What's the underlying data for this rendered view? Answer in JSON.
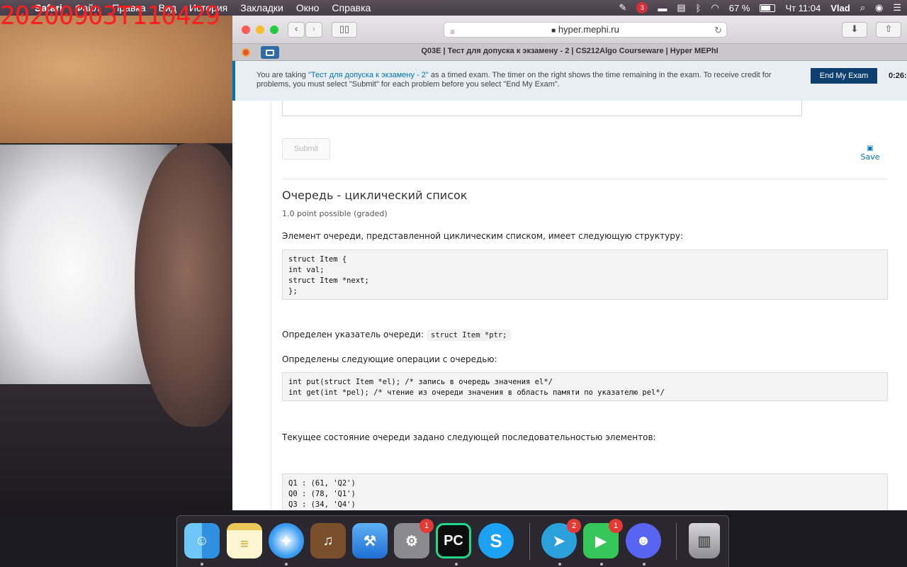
{
  "overlay_timestamp": "20200903T110429",
  "menubar": {
    "app_name": "Safari",
    "items": [
      "Файл",
      "Правка",
      "Вид",
      "История",
      "Закладки",
      "Окно",
      "Справка"
    ],
    "notification_badge": "3",
    "battery": "67 %",
    "clock": "Чт 11:04",
    "user": "Vlad"
  },
  "browser": {
    "url": "hyper.mephi.ru",
    "tab_title": "Q03E | Тест для допуска к экзамену - 2 | CS212Algo Courseware | Hyper MEPhI"
  },
  "exam_notice": {
    "prefix": "You are taking ",
    "exam_link": "\"Тест для допуска к экзамену - 2\"",
    "suffix": " as a timed exam. The timer on the right shows the time remaining in the exam. To receive credit for problems, you must select \"Submit\" for each problem before you select \"End My Exam\".",
    "end_button": "End My Exam",
    "timer": "0:26:"
  },
  "problem": {
    "submit_label": "Submit",
    "save_label": "Save",
    "title": "Очередь - циклический список",
    "points": "1.0 point possible (graded)",
    "intro": "Элемент очереди, представленной циклическим списком, имеет следующую структуру:",
    "struct_code": "struct Item {\nint val;\nstruct Item *next;\n};",
    "pointer_text": "Определен указатель очереди:",
    "pointer_code": "struct Item *ptr;",
    "ops_text": "Определены следующие операции с очередью:",
    "ops_code": "int put(struct Item *el); /* запись в очередь значения el*/\nint get(int *pel); /* чтение из очереди значения в область памяти по указателю pel*/",
    "state_text": "Текущее состояние очереди задано следующей последовательностью элементов:",
    "state_code": "Q1 : (61, 'Q2')\nQ0 : (78, 'Q1')\nQ3 : (34, 'Q4')"
  },
  "dock": {
    "apps": [
      "finder",
      "notes",
      "safari",
      "garageband",
      "xcode",
      "system-preferences",
      "pycharm",
      "skype",
      "telegram",
      "facetime",
      "discord",
      "trash"
    ],
    "system_prefs_badge": "1",
    "telegram_badge": "2",
    "facetime_badge": "1"
  }
}
